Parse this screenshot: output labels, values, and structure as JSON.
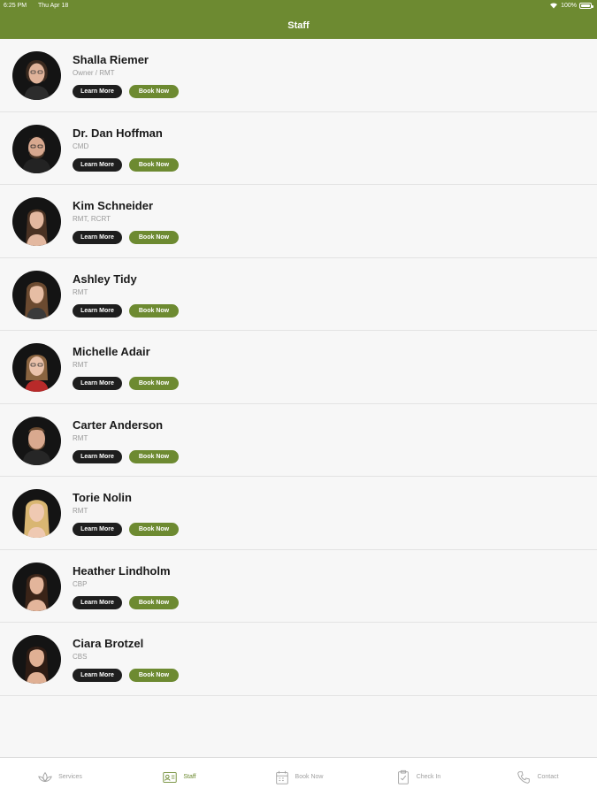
{
  "status": {
    "time": "6:25 PM",
    "date": "Thu Apr 18",
    "battery": "100%",
    "wifi_icon": "wifi-icon"
  },
  "header": {
    "title": "Staff"
  },
  "buttons": {
    "learn": "Learn More",
    "book": "Book Now"
  },
  "staff": [
    {
      "name": "Shalla Riemer",
      "credential": "Owner / RMT"
    },
    {
      "name": "Dr. Dan Hoffman",
      "credential": "CMD"
    },
    {
      "name": "Kim Schneider",
      "credential": "RMT, RCRT"
    },
    {
      "name": "Ashley Tidy",
      "credential": "RMT"
    },
    {
      "name": "Michelle Adair",
      "credential": "RMT"
    },
    {
      "name": "Carter Anderson",
      "credential": "RMT"
    },
    {
      "name": "Torie Nolin",
      "credential": "RMT"
    },
    {
      "name": "Heather Lindholm",
      "credential": "CBP"
    },
    {
      "name": "Ciara Brotzel",
      "credential": "CBS"
    }
  ],
  "tabs": [
    {
      "label": "Services",
      "icon": "lotus-icon"
    },
    {
      "label": "Staff",
      "icon": "id-card-icon"
    },
    {
      "label": "Book Now",
      "icon": "calendar-icon"
    },
    {
      "label": "Check In",
      "icon": "checklist-icon"
    },
    {
      "label": "Contact",
      "icon": "phone-icon"
    }
  ],
  "colors": {
    "brand": "#6d8a31",
    "dark_button": "#1e1e1e"
  }
}
